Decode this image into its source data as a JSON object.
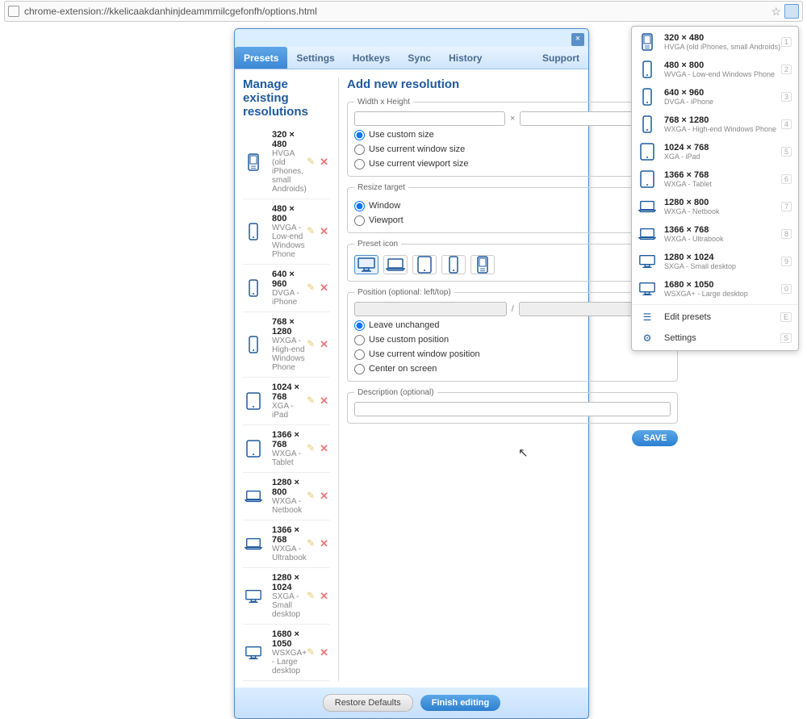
{
  "url": "chrome-extension://kkelicaakdanhinjdeammmilcgefonfh/options.html",
  "tabs": [
    "Presets",
    "Settings",
    "Hotkeys",
    "Sync",
    "History"
  ],
  "support": "Support",
  "headings": {
    "manage": "Manage existing resolutions",
    "add": "Add new resolution"
  },
  "resolutions": [
    {
      "label": "320 × 480",
      "desc": "HVGA (old iPhones, small Androids)",
      "icon": "phone-old",
      "key": "1"
    },
    {
      "label": "480 × 800",
      "desc": "WVGA - Low-end Windows Phone",
      "icon": "phone",
      "key": "2"
    },
    {
      "label": "640 × 960",
      "desc": "DVGA - iPhone",
      "icon": "phone",
      "key": "3"
    },
    {
      "label": "768 × 1280",
      "desc": "WXGA - High-end Windows Phone",
      "icon": "phone",
      "key": "4"
    },
    {
      "label": "1024 × 768",
      "desc": "XGA - iPad",
      "icon": "tablet",
      "key": "5"
    },
    {
      "label": "1366 × 768",
      "desc": "WXGA - Tablet",
      "icon": "tablet",
      "key": "6"
    },
    {
      "label": "1280 × 800",
      "desc": "WXGA - Netbook",
      "icon": "laptop",
      "key": "7"
    },
    {
      "label": "1366 × 768",
      "desc": "WXGA - Ultrabook",
      "icon": "laptop",
      "key": "8"
    },
    {
      "label": "1280 × 1024",
      "desc": "SXGA - Small desktop",
      "icon": "desktop",
      "key": "9"
    },
    {
      "label": "1680 × 1050",
      "desc": "WSXGA+ - Large desktop",
      "icon": "desktop",
      "key": "0"
    }
  ],
  "fieldsets": {
    "wh": "Width x Height",
    "size_opts": [
      "Use custom size",
      "Use current window size",
      "Use current viewport size"
    ],
    "resize_legend": "Resize target",
    "resize_opts": [
      "Window",
      "Viewport"
    ],
    "preset_icon": "Preset icon",
    "position_legend": "Position (optional: left/top)",
    "position_opts": [
      "Leave unchanged",
      "Use custom position",
      "Use current window position",
      "Center on screen"
    ],
    "desc_legend": "Description (optional)"
  },
  "buttons": {
    "save": "SAVE",
    "restore": "Restore Defaults",
    "finish": "Finish editing"
  },
  "popup_options": {
    "edit": "Edit presets",
    "settings": "Settings"
  }
}
